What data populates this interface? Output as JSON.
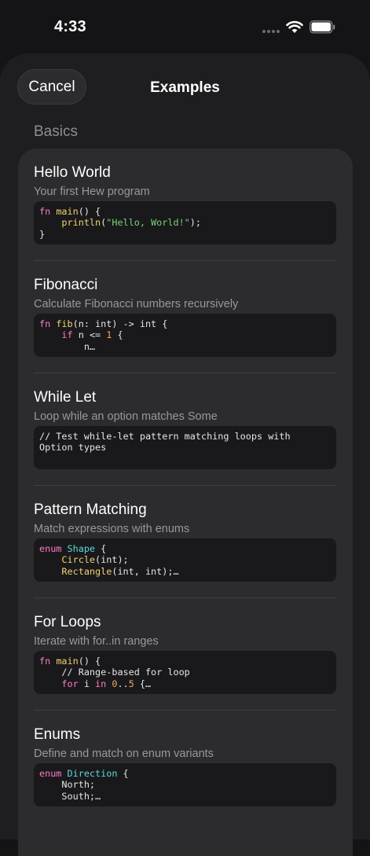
{
  "status_bar": {
    "time": "4:33",
    "icons": [
      "signal-dots-icon",
      "wifi-icon",
      "battery-icon"
    ]
  },
  "header": {
    "cancel_label": "Cancel",
    "title": "Examples"
  },
  "section": {
    "title": "Basics"
  },
  "colors": {
    "background": "#141416",
    "sheet": "#1e1e20",
    "card": "#2c2c2e",
    "code_bg": "#19191b",
    "keyword": "#ff79c6",
    "function": "#f1d36f",
    "string": "#7ad07a",
    "number": "#f2a65a",
    "type": "#5fd7d7"
  },
  "examples": [
    {
      "title": "Hello World",
      "description": "Your first Hew program",
      "code": [
        [
          [
            "keyword",
            "fn "
          ],
          [
            "function",
            "main"
          ],
          [
            "plain",
            "() {"
          ]
        ],
        [
          [
            "plain",
            "    "
          ],
          [
            "function",
            "println"
          ],
          [
            "plain",
            "("
          ],
          [
            "string",
            "\"Hello, World!\""
          ],
          [
            "plain",
            ");"
          ]
        ],
        [
          [
            "plain",
            "}"
          ]
        ]
      ]
    },
    {
      "title": "Fibonacci",
      "description": "Calculate Fibonacci numbers recursively",
      "code": [
        [
          [
            "keyword",
            "fn "
          ],
          [
            "function",
            "fib"
          ],
          [
            "plain",
            "(n: int) -> int {"
          ]
        ],
        [
          [
            "plain",
            "    "
          ],
          [
            "keyword",
            "if"
          ],
          [
            "plain",
            " n <= "
          ],
          [
            "number",
            "1"
          ],
          [
            "plain",
            " {"
          ]
        ],
        [
          [
            "plain",
            "        n…"
          ]
        ]
      ]
    },
    {
      "title": "While Let",
      "description": "Loop while an option matches Some",
      "code": [
        [
          [
            "comment",
            "// Test while-let pattern matching loops with"
          ]
        ],
        [
          [
            "comment",
            "Option types"
          ]
        ]
      ]
    },
    {
      "title": "Pattern Matching",
      "description": "Match expressions with enums",
      "code": [
        [
          [
            "keyword",
            "enum "
          ],
          [
            "type",
            "Shape"
          ],
          [
            "plain",
            " {"
          ]
        ],
        [
          [
            "plain",
            "    "
          ],
          [
            "function",
            "Circle"
          ],
          [
            "plain",
            "(int);"
          ]
        ],
        [
          [
            "plain",
            "    "
          ],
          [
            "function",
            "Rectangle"
          ],
          [
            "plain",
            "(int, int);…"
          ]
        ]
      ]
    },
    {
      "title": "For Loops",
      "description": "Iterate with for..in ranges",
      "code": [
        [
          [
            "keyword",
            "fn "
          ],
          [
            "function",
            "main"
          ],
          [
            "plain",
            "() {"
          ]
        ],
        [
          [
            "plain",
            "    "
          ],
          [
            "comment",
            "// Range-based for loop"
          ]
        ],
        [
          [
            "plain",
            "    "
          ],
          [
            "keyword",
            "for"
          ],
          [
            "plain",
            " i "
          ],
          [
            "keyword",
            "in"
          ],
          [
            "plain",
            " "
          ],
          [
            "number",
            "0"
          ],
          [
            "plain",
            ".."
          ],
          [
            "number",
            "5"
          ],
          [
            "plain",
            " {…"
          ]
        ]
      ]
    },
    {
      "title": "Enums",
      "description": "Define and match on enum variants",
      "code": [
        [
          [
            "keyword",
            "enum "
          ],
          [
            "type",
            "Direction"
          ],
          [
            "plain",
            " {"
          ]
        ],
        [
          [
            "plain",
            "    North;"
          ]
        ],
        [
          [
            "plain",
            "    South;…"
          ]
        ]
      ]
    }
  ]
}
